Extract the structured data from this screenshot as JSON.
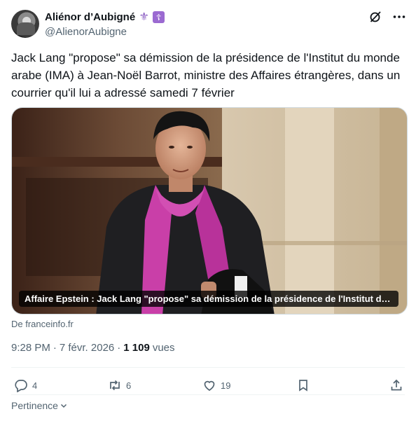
{
  "author": {
    "display_name": "Aliénor d’Aubigné",
    "emoji_1": "⚜",
    "emoji_2": "☦",
    "handle": "@AlienorAubigne"
  },
  "tweet": {
    "text": "Jack Lang \"propose\" sa démission de la présidence de l'Institut du monde arabe (IMA) à Jean-Noël Barrot, ministre des Affaires étrangères, dans un courrier qu'il lui a adressé samedi 7 février"
  },
  "card": {
    "caption": "Affaire Epstein : Jack Lang \"propose\" sa démission de la présidence de l'Institut du mo...",
    "source": "De franceinfo.fr"
  },
  "meta": {
    "time": "9:28 PM",
    "separator": "·",
    "date": "7 févr. 2026",
    "views_count": "1 109",
    "views_label": "vues"
  },
  "actions": {
    "replies": "4",
    "reposts": "6",
    "likes": "19"
  },
  "footer": {
    "pertinence": "Pertinence"
  },
  "icons": {
    "grok": "grok-slash-circle-icon",
    "more": "more-horizontal-icon",
    "reply": "speech-bubble-icon",
    "repost": "repost-arrows-icon",
    "like": "heart-icon",
    "bookmark": "bookmark-icon",
    "share": "share-upload-icon",
    "chevron": "chevron-down-icon"
  },
  "colors": {
    "text_primary": "#0f1419",
    "text_secondary": "#536471",
    "scarf_pink": "#c93fa8",
    "emoji_purple": "#9b6ad1"
  }
}
